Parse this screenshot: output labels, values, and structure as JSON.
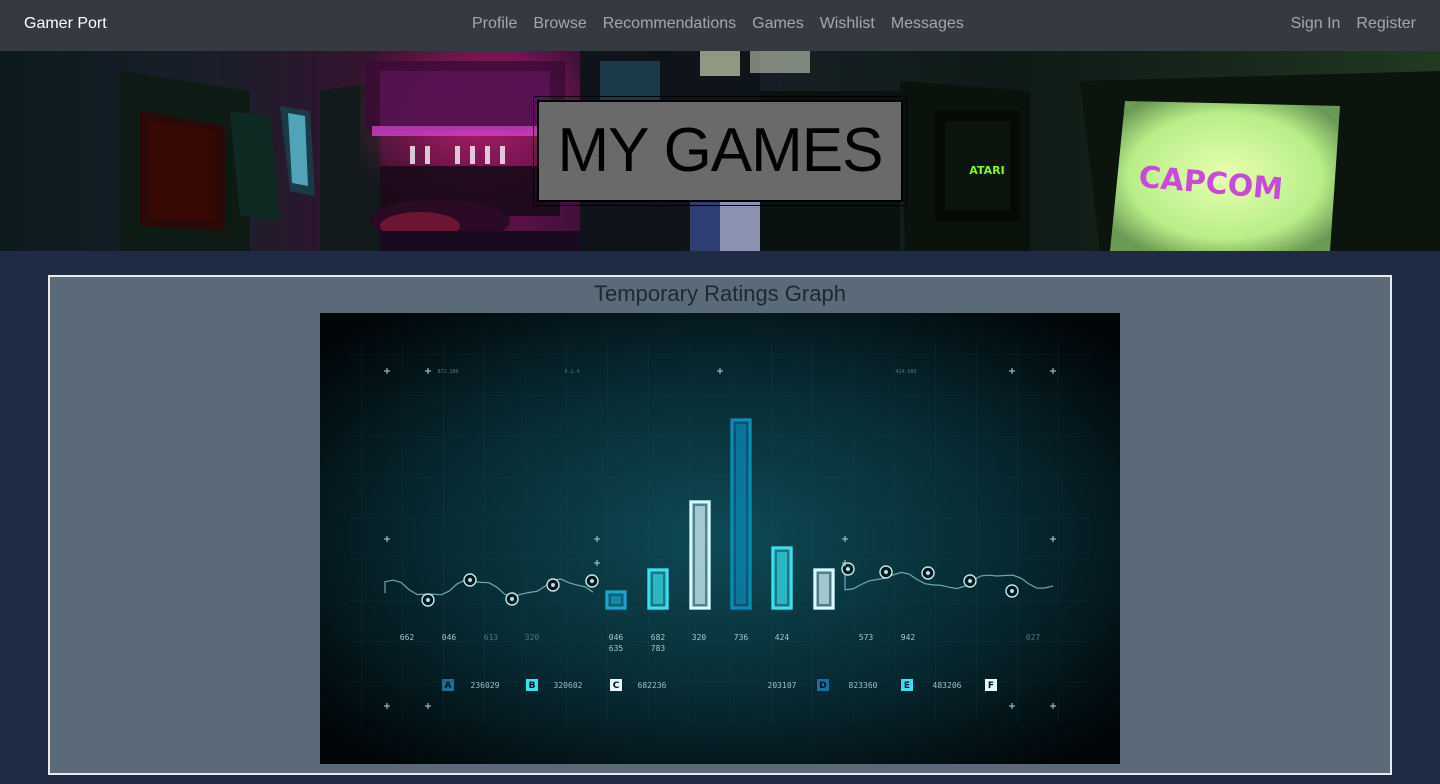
{
  "nav": {
    "brand": "Gamer Port",
    "links": [
      "Profile",
      "Browse",
      "Recommendations",
      "Games",
      "Wishlist",
      "Messages"
    ],
    "auth": [
      "Sign In",
      "Register"
    ]
  },
  "hero": {
    "title": "MY GAMES",
    "sign_capcom": "CAPCOM",
    "sign_atari": "ATARI"
  },
  "panel": {
    "title": "Temporary Ratings Graph"
  },
  "graph": {
    "bar_levels": [
      0.1,
      0.21,
      0.55,
      0.96,
      0.32,
      0.21
    ],
    "bar_colors": [
      "#1aa4cc",
      "#3be0f0",
      "#d8f8ff",
      "#0a8cb8",
      "#3be0f0",
      "#d8f8ff"
    ],
    "numbers_row1": [
      "662",
      "046",
      "613",
      "320",
      "046",
      "682",
      "320",
      "736",
      "424",
      "573",
      "942",
      "027"
    ],
    "numbers_row2": [
      "635",
      "783"
    ],
    "legend": [
      {
        "key": "A",
        "code": "236029",
        "color": "#1a6e9a"
      },
      {
        "key": "B",
        "code": "320602",
        "color": "#3be0f0"
      },
      {
        "key": "C",
        "code": "682236",
        "color": "#e8f8ff"
      },
      {
        "key": "D",
        "code": "203107",
        "color": "#1a6e9a",
        "code_first": true
      },
      {
        "key": "E",
        "code": "823360",
        "color": "#3be0f0"
      },
      {
        "key": "F",
        "code": "483206",
        "color": "#e8f8ff",
        "code_first": true
      }
    ],
    "corner_labels": [
      "871.186",
      "0.2.4",
      "424.580"
    ]
  }
}
